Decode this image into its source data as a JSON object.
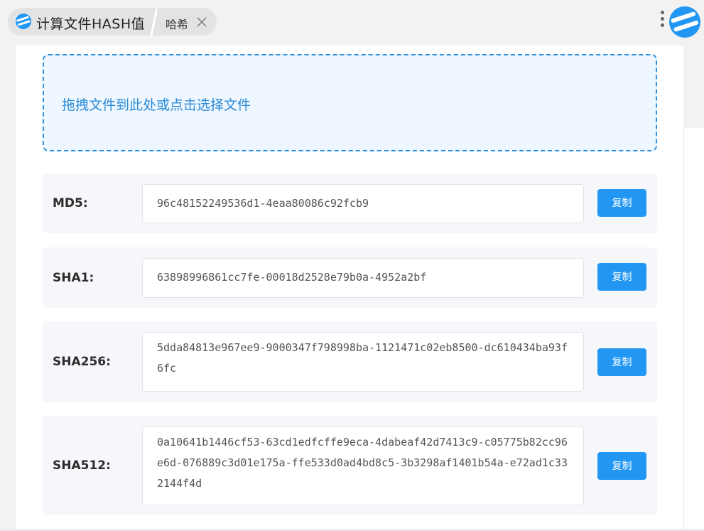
{
  "header": {
    "app_title": "计算文件HASH值",
    "tab_label": "哈希",
    "app_icon": "app-logo-icon",
    "close_icon": "close-icon",
    "menu_icon": "more-vertical-icon",
    "corner_icon": "app-logo-icon"
  },
  "dropzone": {
    "text": "拖拽文件到此处或点击选择文件"
  },
  "hashes": [
    {
      "label": "MD5:",
      "value": "96c48152249536d1-4eaa80086c92fcb9",
      "button": "复制"
    },
    {
      "label": "SHA1:",
      "value": "63898996861cc7fe-00018d2528e79b0a-4952a2bf",
      "button": "复制"
    },
    {
      "label": "SHA256:",
      "value": "5dda84813e967ee9-9000347f798998ba-1121471c02eb8500-dc610434ba93f6fc",
      "button": "复制"
    },
    {
      "label": "SHA512:",
      "value": "0a10641b1446cf53-63cd1edfcffe9eca-4dabeaf42d7413c9-c05775b82cc96e6d-076889c3d01e175a-ffe533d0ad4bd8c5-3b3298af1401b54a-e72ad1c332144f4d",
      "button": "复制"
    }
  ],
  "colors": {
    "accent": "#2196f3",
    "dropzone_border": "#2f90e0",
    "dropzone_bg": "#eef7ff",
    "row_bg": "#f5f7fa"
  }
}
